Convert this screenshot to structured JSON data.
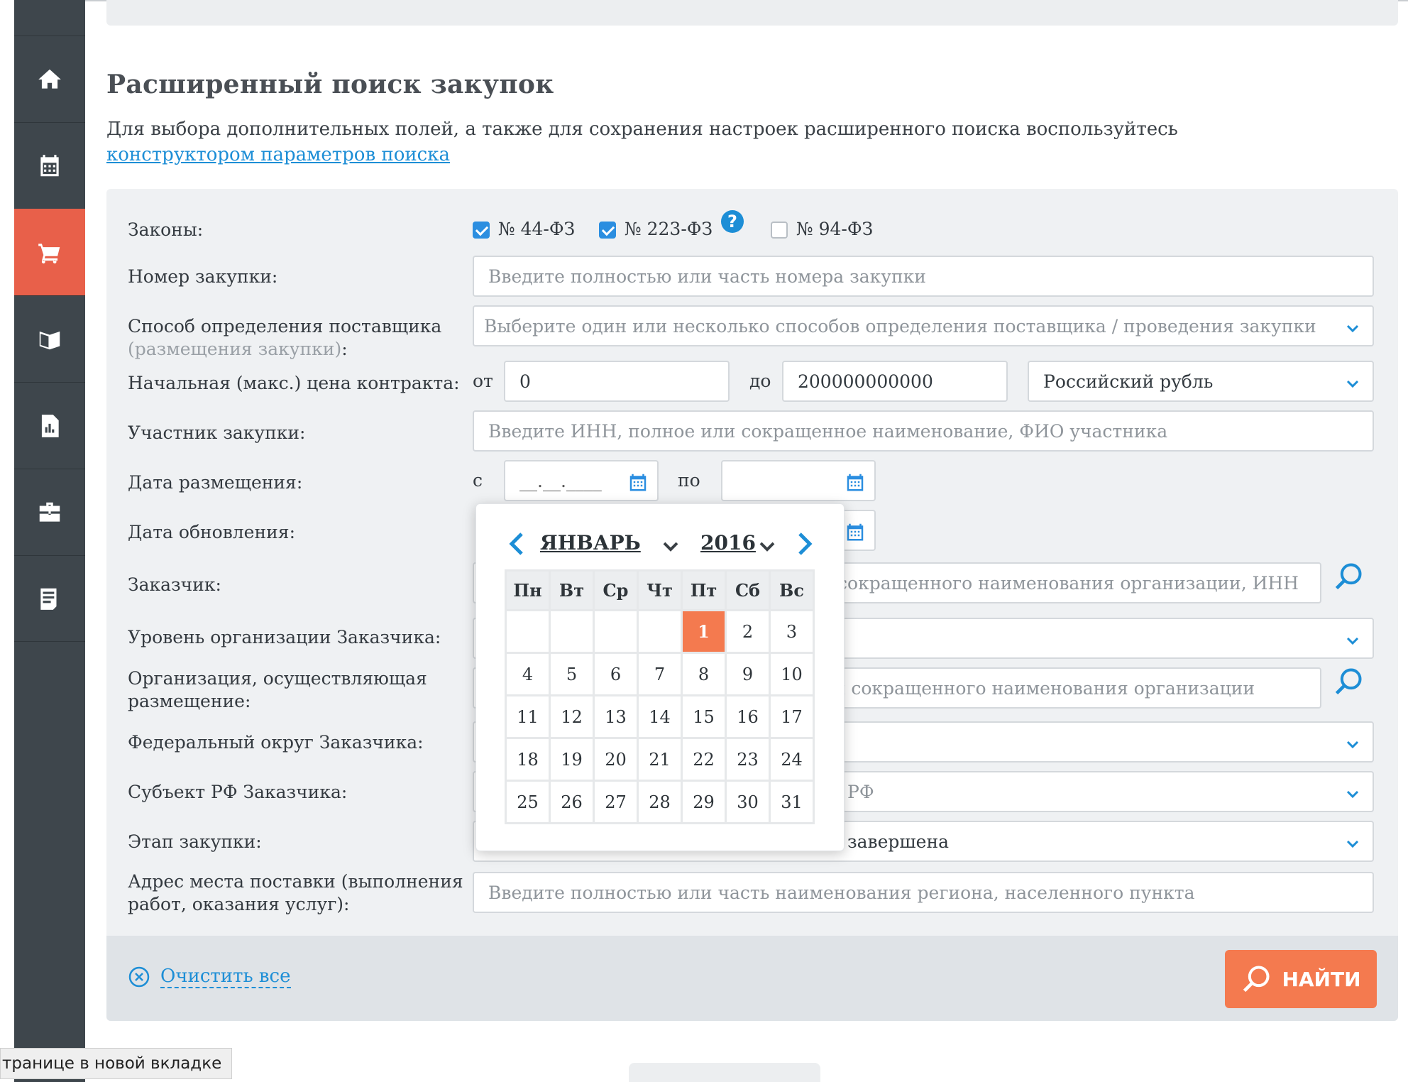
{
  "page": {
    "title": "Расширенный поиск закупок",
    "intro_text": "Для выбора дополнительных полей, а также для сохранения настроек расширенного поиска воспользуйтесь ",
    "intro_link": "конструктором параметров поиска"
  },
  "sidebar": {
    "items": [
      {
        "icon": "home-icon"
      },
      {
        "icon": "calendar-icon"
      },
      {
        "icon": "cart-icon",
        "active": true
      },
      {
        "icon": "book-icon"
      },
      {
        "icon": "report-icon"
      },
      {
        "icon": "briefcase-icon"
      },
      {
        "icon": "document-icon"
      }
    ]
  },
  "form": {
    "laws": {
      "label": "Законы:",
      "options": [
        {
          "label": "№ 44-ФЗ",
          "checked": true
        },
        {
          "label": "№ 223-ФЗ",
          "checked": true
        },
        {
          "label": "№ 94-ФЗ",
          "checked": false
        }
      ],
      "help": "?"
    },
    "purchase_number": {
      "label": "Номер закупки:",
      "placeholder": "Введите полностью или часть номера закупки"
    },
    "supplier_method": {
      "label": "Способ определения поставщика",
      "label_muted": "(размещения закупки)",
      "label_tail": ":",
      "placeholder": "Выберите один или несколько способов определения поставщика / проведения закупки"
    },
    "price": {
      "label": "Начальная (макс.) цена контракта:",
      "from_label": "от",
      "from_value": "0",
      "to_label": "до",
      "to_value": "200000000000",
      "currency": "Российский рубль"
    },
    "participant": {
      "label": "Участник закупки:",
      "placeholder": "Введите ИНН, полное или сокращенное наименование, ФИО участника"
    },
    "placement_date": {
      "label": "Дата размещения:",
      "from_label": "с",
      "from_value": "__.__.____",
      "to_label": "по",
      "to_value": ""
    },
    "update_date": {
      "label": "Дата обновления:"
    },
    "customer": {
      "label": "Заказчик:",
      "visible_text": "или сокращенного наименования организации, ИНН"
    },
    "customer_level": {
      "label": "Уровень организации Заказчика:"
    },
    "placing_org": {
      "label_line1": "Организация, осуществляющая",
      "label_line2": "размещение:",
      "visible_text": "или сокращенного наименования организации"
    },
    "federal_district": {
      "label": "Федеральный округ Заказчика:"
    },
    "subject": {
      "label": "Субъект РФ Заказчика:",
      "visible_text": "РФ"
    },
    "stage": {
      "label": "Этап закупки:",
      "visible_text": "завершена"
    },
    "delivery_address": {
      "label_line1": "Адрес места поставки (выполнения",
      "label_line2": "работ, оказания услуг):",
      "placeholder": "Введите полностью или часть наименования региона, населенного пункта"
    }
  },
  "calendar": {
    "month": "ЯНВАРЬ",
    "year": "2016",
    "weekdays": [
      "Пн",
      "Вт",
      "Ср",
      "Чт",
      "Пт",
      "Сб",
      "Вс"
    ],
    "weeks": [
      [
        "",
        "",
        "",
        "",
        "1",
        "2",
        "3"
      ],
      [
        "4",
        "5",
        "6",
        "7",
        "8",
        "9",
        "10"
      ],
      [
        "11",
        "12",
        "13",
        "14",
        "15",
        "16",
        "17"
      ],
      [
        "18",
        "19",
        "20",
        "21",
        "22",
        "23",
        "24"
      ],
      [
        "25",
        "26",
        "27",
        "28",
        "29",
        "30",
        "31"
      ]
    ],
    "selected": "1"
  },
  "footer": {
    "clear_label": "Очистить все",
    "find_label": "НАЙТИ"
  },
  "browser": {
    "tooltip": "транице в новой вкладке"
  },
  "colors": {
    "accent": "#f47a4f",
    "link": "#1d8ed6",
    "sidebar": "#3e464c",
    "sidebar_active": "#e8604a"
  }
}
